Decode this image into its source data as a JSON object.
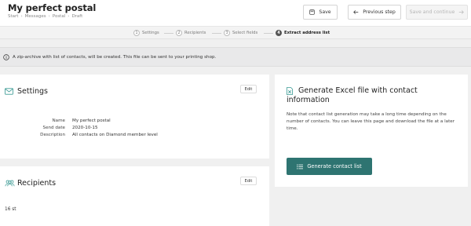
{
  "header": {
    "title": "My perfect postal",
    "breadcrumb": [
      "Start",
      "Messages",
      "Postal",
      "Draft"
    ],
    "save_label": "Save",
    "prev_label": "Previous step",
    "next_label": "Save and continue"
  },
  "stepper": {
    "steps": [
      {
        "num": "1",
        "label": "Settings"
      },
      {
        "num": "2",
        "label": "Recipients"
      },
      {
        "num": "3",
        "label": "Select fields"
      },
      {
        "num": "4",
        "label": "Extract address list"
      }
    ],
    "active_step": "4"
  },
  "banner": {
    "text": "A zip-archive with list of contacts, will be created. This file can be sent to your printing shop."
  },
  "settings": {
    "title": "Settings",
    "edit_label": "Edit",
    "fields": [
      {
        "label": "Name",
        "value": "My perfect postal"
      },
      {
        "label": "Send date",
        "value": "2020-10-15"
      },
      {
        "label": "Description",
        "value": "All contacts on Diamond member level"
      }
    ]
  },
  "recipients": {
    "title": "Recipients",
    "edit_label": "Edit",
    "count": "16 st"
  },
  "generate": {
    "title_line1": "Generate Excel file with contact",
    "title_line2": "information",
    "note": "Note that contact list generation may take a long time depending on the number of contacts. You can leave this page and download the file at a later time.",
    "button_label": "Generate contact list"
  },
  "colors": {
    "accent": "#2e7471",
    "icon_teal": "#3a9a94",
    "background": "#f0f0f0"
  }
}
